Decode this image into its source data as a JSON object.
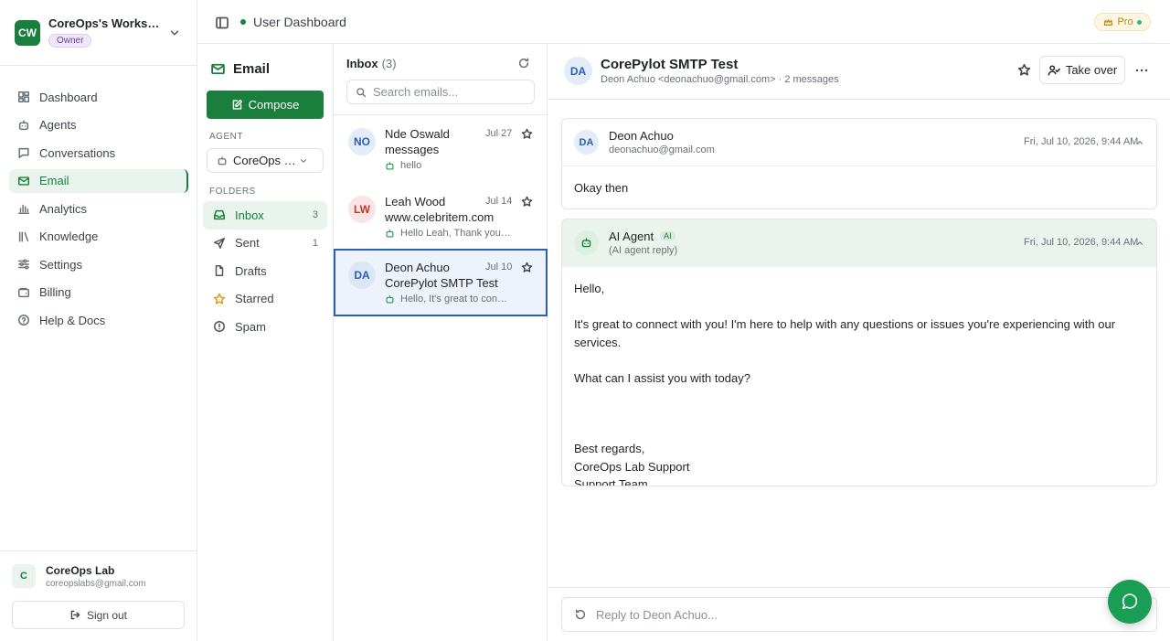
{
  "workspace": {
    "initials": "CW",
    "name": "CoreOps's Workspace",
    "role": "Owner"
  },
  "nav": [
    {
      "label": "Dashboard",
      "icon": "dashboard-icon"
    },
    {
      "label": "Agents",
      "icon": "bot-icon"
    },
    {
      "label": "Conversations",
      "icon": "chat-icon"
    },
    {
      "label": "Email",
      "icon": "mail-icon",
      "active": true
    },
    {
      "label": "Analytics",
      "icon": "bar-chart-icon"
    },
    {
      "label": "Knowledge",
      "icon": "library-icon"
    },
    {
      "label": "Settings",
      "icon": "sliders-icon"
    },
    {
      "label": "Billing",
      "icon": "wallet-icon"
    },
    {
      "label": "Help & Docs",
      "icon": "help-icon"
    }
  ],
  "user": {
    "initial": "C",
    "name": "CoreOps Lab",
    "email": "coreopslabs@gmail.com",
    "signout": "Sign out"
  },
  "topbar": {
    "title": "User Dashboard",
    "plan": "Pro"
  },
  "email_pane": {
    "title": "Email",
    "compose": "Compose",
    "agent_label": "AGENT",
    "agent_value": "CoreOps Lab",
    "folders_label": "FOLDERS",
    "folders": [
      {
        "label": "Inbox",
        "count": "3",
        "active": true
      },
      {
        "label": "Sent",
        "count": "1"
      },
      {
        "label": "Drafts",
        "count": ""
      },
      {
        "label": "Starred",
        "count": ""
      },
      {
        "label": "Spam",
        "count": ""
      }
    ]
  },
  "inbox": {
    "title": "Inbox",
    "count": "(3)",
    "search_placeholder": "Search emails...",
    "messages": [
      {
        "initials": "NO",
        "from": "Nde Oswald",
        "date": "Jul 27",
        "subject": "messages",
        "preview": "hello"
      },
      {
        "initials": "LW",
        "from": "Leah Wood",
        "date": "Jul 14",
        "subject": "www.celebritem.com",
        "preview": "Hello Leah, Thank you fo..."
      },
      {
        "initials": "DA",
        "from": "Deon Achuo",
        "date": "Jul 10",
        "subject": "CorePylot SMTP Test",
        "preview": "Hello, It's great to conne...",
        "selected": true
      }
    ]
  },
  "thread": {
    "initials": "DA",
    "subject": "CorePylot SMTP Test",
    "meta": "Deon Achuo <deonachuo@gmail.com> · 2 messages",
    "takeover": "Take over",
    "messages": [
      {
        "initials": "DA",
        "from": "Deon Achuo",
        "sub": "deonachuo@gmail.com",
        "date": "Fri, Jul 10, 2026, 9:44 AM",
        "body": [
          "Okay then"
        ]
      },
      {
        "from": "AI Agent",
        "badge": "AI",
        "sub": "(AI agent reply)",
        "date": "Fri, Jul 10, 2026, 9:44 AM",
        "body": [
          "Hello,",
          "It's great to connect with you! I'm here to help with any questions or issues you're experiencing with our services.",
          "What can I assist you with today?",
          "Best regards,",
          "CoreOps Lab Support",
          "Support Team"
        ]
      }
    ],
    "reply_placeholder": "Reply to Deon Achuo..."
  },
  "colors": {
    "accent": "#1a7f3c",
    "selected_border": "#2b5fb4"
  }
}
